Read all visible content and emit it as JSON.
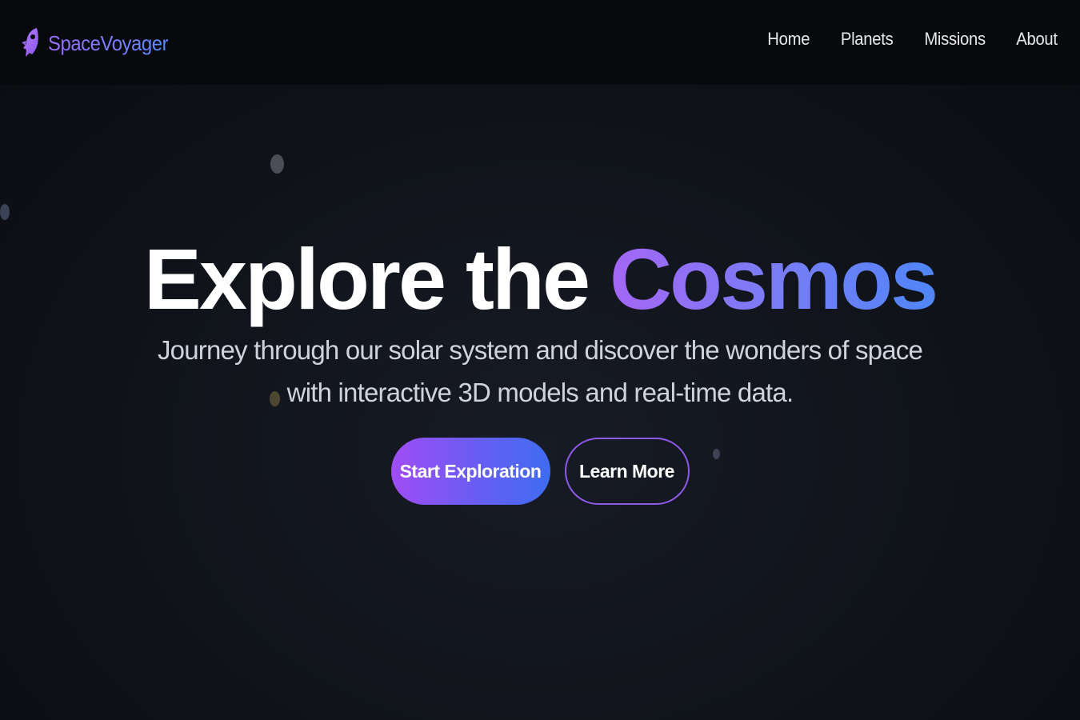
{
  "brand": {
    "name": "SpaceVoyager",
    "icon": "rocket-icon",
    "gradient": [
      "#9b6cff",
      "#5b8bff"
    ]
  },
  "nav": {
    "items": [
      {
        "label": "Home"
      },
      {
        "label": "Planets"
      },
      {
        "label": "Missions"
      },
      {
        "label": "About"
      }
    ]
  },
  "hero": {
    "title_part1": "Explore the ",
    "title_part2": "Cosmos",
    "subtitle": "Journey through our solar system and discover the wonders of space with interactive 3D models and real-time data.",
    "primary_button": "Start Exploration",
    "secondary_button": "Learn More"
  },
  "colors": {
    "background": "#0d0f15",
    "navbar": "#08090c",
    "accent_purple": "#a04df5",
    "accent_blue": "#3f6cf2"
  }
}
